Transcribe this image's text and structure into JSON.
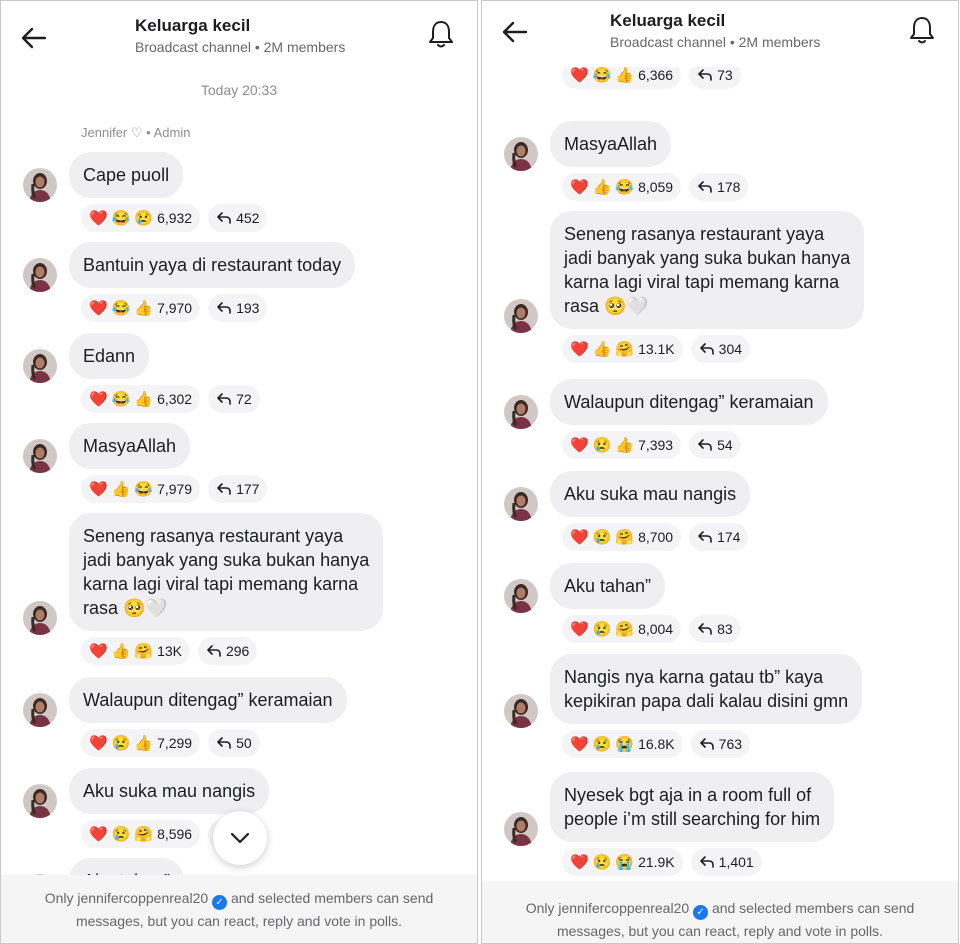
{
  "channel": {
    "title": "Keluarga kecil",
    "subtitle": "Broadcast channel • 2M members"
  },
  "left": {
    "date": "Today 20:33",
    "sender": "Jennifer ♡",
    "sender_role": "• Admin",
    "messages": [
      {
        "text": "Cape puoll",
        "reactions": [
          "❤️",
          "😂",
          "😢"
        ],
        "count": "6,932",
        "replies": "452"
      },
      {
        "text": "Bantuin yaya di restaurant today",
        "reactions": [
          "❤️",
          "😂",
          "👍"
        ],
        "count": "7,970",
        "replies": "193"
      },
      {
        "text": "Edann",
        "reactions": [
          "❤️",
          "😂",
          "👍"
        ],
        "count": "6,302",
        "replies": "72"
      },
      {
        "text": "MasyaAllah",
        "reactions": [
          "❤️",
          "👍",
          "😂"
        ],
        "count": "7,979",
        "replies": "177"
      },
      {
        "text": "Seneng rasanya restaurant yaya\njadi banyak yang suka bukan hanya\nkarna lagi viral tapi memang karna\nrasa 🥺🤍",
        "reactions": [
          "❤️",
          "👍",
          "🤗"
        ],
        "count": "13K",
        "replies": "296"
      },
      {
        "text": "Walaupun ditengag” keramaian",
        "reactions": [
          "❤️",
          "😢",
          "👍"
        ],
        "count": "7,299",
        "replies": "50"
      },
      {
        "text": "Aku suka mau nangis",
        "reactions": [
          "❤️",
          "😢",
          "🤗"
        ],
        "count": "8,596",
        "replies": ""
      },
      {
        "text": "Aku tahan”",
        "reactions": [],
        "count": "",
        "replies": ""
      }
    ]
  },
  "right": {
    "messages": [
      {
        "text": "",
        "reactions": [
          "❤️",
          "😂",
          "👍"
        ],
        "count": "6,366",
        "replies": "73"
      },
      {
        "text": "MasyaAllah",
        "reactions": [
          "❤️",
          "👍",
          "😂"
        ],
        "count": "8,059",
        "replies": "178"
      },
      {
        "text": "Seneng rasanya restaurant yaya\njadi banyak yang suka bukan hanya\nkarna lagi viral tapi memang karna\nrasa 🥺🤍",
        "reactions": [
          "❤️",
          "👍",
          "🤗"
        ],
        "count": "13.1K",
        "replies": "304"
      },
      {
        "text": "Walaupun ditengag” keramaian",
        "reactions": [
          "❤️",
          "😢",
          "👍"
        ],
        "count": "7,393",
        "replies": "54"
      },
      {
        "text": "Aku suka mau nangis",
        "reactions": [
          "❤️",
          "😢",
          "🤗"
        ],
        "count": "8,700",
        "replies": "174"
      },
      {
        "text": "Aku tahan”",
        "reactions": [
          "❤️",
          "😢",
          "🤗"
        ],
        "count": "8,004",
        "replies": "83"
      },
      {
        "text": "Nangis nya karna gatau tb” kaya\nkepikiran papa dali kalau disini gmn",
        "reactions": [
          "❤️",
          "😢",
          "😭"
        ],
        "count": "16.8K",
        "replies": "763"
      },
      {
        "text": "Nyesek bgt aja in a room full of\npeople i’m still searching for him",
        "reactions": [
          "❤️",
          "😢",
          "😭"
        ],
        "count": "21.9K",
        "replies": "1,401"
      }
    ]
  },
  "footer": {
    "prefix": "Only jennifercoppenreal20",
    "suffix": "and selected members can send",
    "line2": "messages, but you can react, reply and vote in polls."
  },
  "colors": {
    "accent": "#1877f2",
    "bubble": "#efeff1",
    "muted": "#65676b"
  },
  "icons": {
    "back": "back-arrow-icon",
    "bell": "bell-icon",
    "reply": "reply-icon",
    "scroll": "chevron-down-icon",
    "verified": "verified-badge-icon"
  }
}
